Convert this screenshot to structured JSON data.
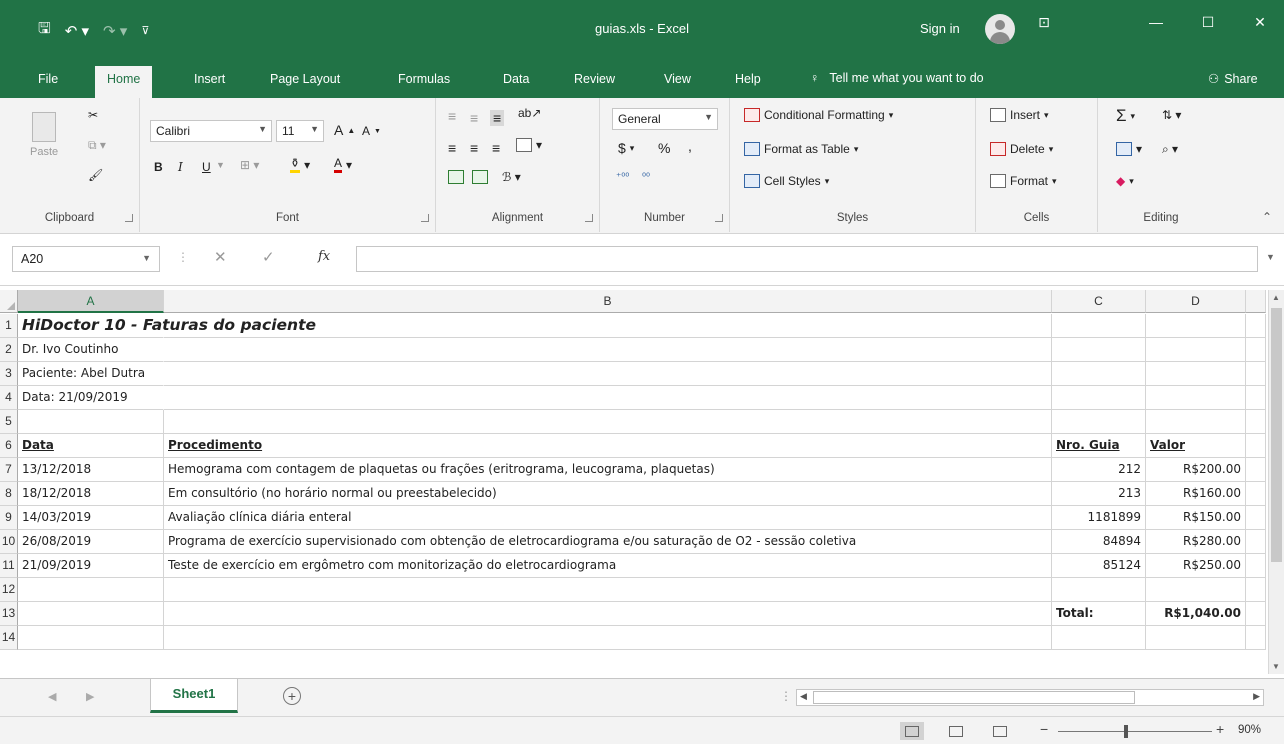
{
  "app": {
    "doc_title": "guias.xls  -  Excel",
    "sign_in": "Sign in",
    "accent_color": "#217346"
  },
  "ribbon_tabs": [
    "File",
    "Home",
    "Insert",
    "Page Layout",
    "Formulas",
    "Data",
    "Review",
    "View",
    "Help"
  ],
  "tell_me": "Tell me what you want to do",
  "share": "Share",
  "ribbon": {
    "clipboard": {
      "label": "Clipboard",
      "paste": "Paste"
    },
    "font": {
      "label": "Font",
      "name": "Calibri",
      "size": "11",
      "bold": "B",
      "italic": "I",
      "underline": "U",
      "grow": "A",
      "shrink": "A",
      "color_letter": "A"
    },
    "alignment": {
      "label": "Alignment"
    },
    "number": {
      "label": "Number",
      "format": "General",
      "currency": "$",
      "percent": "%",
      "comma": ",",
      "dec_inc": ".0→.00",
      "dec_dec": ".00→.0"
    },
    "styles": {
      "label": "Styles",
      "conditional": "Conditional Formatting",
      "format_table": "Format as Table",
      "cell_styles": "Cell Styles"
    },
    "cells": {
      "label": "Cells",
      "insert": "Insert",
      "delete": "Delete",
      "format": "Format"
    },
    "editing": {
      "label": "Editing",
      "sum": "Σ"
    }
  },
  "formula_bar": {
    "name_box": "A20",
    "formula": ""
  },
  "columns": [
    {
      "name": "A",
      "selected": true
    },
    {
      "name": "B",
      "selected": false
    },
    {
      "name": "C",
      "selected": false
    },
    {
      "name": "D",
      "selected": false
    }
  ],
  "rows": [
    {
      "n": "1",
      "a": "HiDoctor 10 - Faturas do paciente",
      "b": "",
      "c": "",
      "d": ""
    },
    {
      "n": "2",
      "a": "Dr. Ivo Coutinho",
      "b": "",
      "c": "",
      "d": ""
    },
    {
      "n": "3",
      "a": "Paciente: Abel Dutra",
      "b": "",
      "c": "",
      "d": ""
    },
    {
      "n": "4",
      "a": "Data: 21/09/2019",
      "b": "",
      "c": "",
      "d": ""
    },
    {
      "n": "5",
      "a": "",
      "b": "",
      "c": "",
      "d": ""
    },
    {
      "n": "6",
      "a": "Data",
      "b": "Procedimento",
      "c": "Nro. Guia",
      "d": "Valor"
    },
    {
      "n": "7",
      "a": "13/12/2018",
      "b": "Hemograma com contagem de plaquetas ou frações (eritrograma, leucograma, plaquetas)",
      "c": "212",
      "d": "R$200.00"
    },
    {
      "n": "8",
      "a": "18/12/2018",
      "b": "Em consultório (no horário normal ou preestabelecido)",
      "c": "213",
      "d": "R$160.00"
    },
    {
      "n": "9",
      "a": "14/03/2019",
      "b": "Avaliação clínica diária enteral",
      "c": "1181899",
      "d": "R$150.00"
    },
    {
      "n": "10",
      "a": "26/08/2019",
      "b": "Programa de exercício supervisionado com obtenção de eletrocardiograma e/ou saturação de O2 - sessão coletiva",
      "c": "84894",
      "d": "R$280.00"
    },
    {
      "n": "11",
      "a": "21/09/2019",
      "b": "Teste de exercício em ergômetro com  monitorização  do eletrocardiograma",
      "c": "85124",
      "d": "R$250.00"
    },
    {
      "n": "12",
      "a": "",
      "b": "",
      "c": "",
      "d": ""
    },
    {
      "n": "13",
      "a": "",
      "b": "",
      "c": "Total:",
      "d": "R$1,040.00"
    },
    {
      "n": "14",
      "a": "",
      "b": "",
      "c": "",
      "d": ""
    }
  ],
  "sheets": [
    "Sheet1"
  ],
  "status": {
    "zoom": "90%"
  }
}
